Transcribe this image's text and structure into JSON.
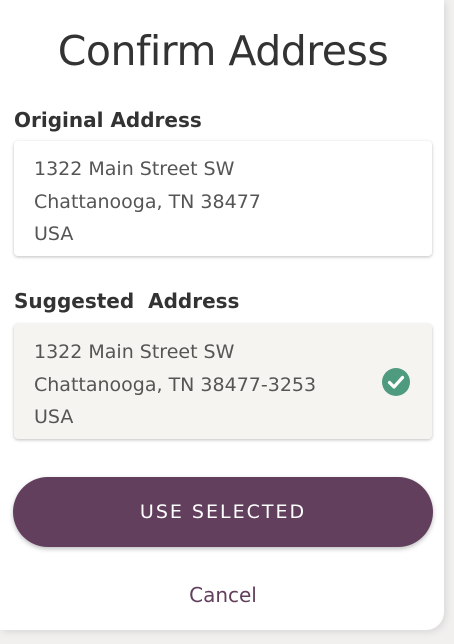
{
  "dialog": {
    "title": "Confirm Address",
    "original": {
      "label": "Original Address",
      "lines": [
        "1322 Main Street SW",
        "Chattanooga, TN 38477",
        "USA"
      ]
    },
    "suggested": {
      "label": "Suggested  Address",
      "lines": [
        "1322 Main Street SW",
        "Chattanooga, TN 38477-3253",
        "USA"
      ],
      "selected": true,
      "selected_icon": "check-circle-icon"
    },
    "primary_button_label": "USE SELECTED",
    "cancel_label": "Cancel"
  },
  "colors": {
    "primary": "#62405d",
    "check": "#4f9b80",
    "text": "#333333",
    "address_text": "#555555",
    "suggested_bg": "#f5f4f0"
  }
}
